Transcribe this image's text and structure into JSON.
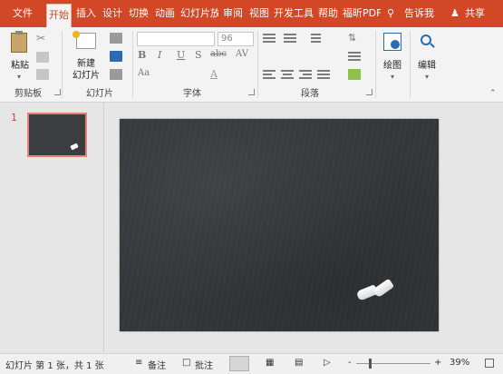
{
  "tabs": {
    "file": "文件",
    "home": "开始",
    "insert": "插入",
    "design": "设计",
    "transitions": "切换",
    "animations": "动画",
    "slideshow": "幻灯片放",
    "review": "审阅",
    "view": "视图",
    "developer": "开发工具",
    "help": "帮助",
    "foxit_pdf": "福昕PDF",
    "tell_me": "告诉我",
    "share": "共享"
  },
  "ribbon": {
    "clipboard": {
      "paste_label": "粘贴",
      "group_label": "剪贴板"
    },
    "slides": {
      "new_slide_line1": "新建",
      "new_slide_line2": "幻灯片",
      "group_label": "幻灯片"
    },
    "font": {
      "font_name": "",
      "font_size": "96",
      "group_label": "字体",
      "bold": "B",
      "italic": "I",
      "underline": "U",
      "shadow": "S",
      "strike": "abc",
      "spacing": "AV",
      "case": "Aa",
      "color": "A"
    },
    "paragraph": {
      "group_label": "段落"
    },
    "drawing": {
      "label": "绘图"
    },
    "editing": {
      "label": "编辑"
    }
  },
  "slides_panel": {
    "slide_number": "1"
  },
  "status": {
    "slide_info": "幻灯片 第 1 张，共 1 张",
    "notes": "备注",
    "comments": "批注",
    "zoom": "39%",
    "minus": "-",
    "plus": "+"
  },
  "colors": {
    "accent": "#d24726",
    "chalkboard": "#33373a"
  }
}
